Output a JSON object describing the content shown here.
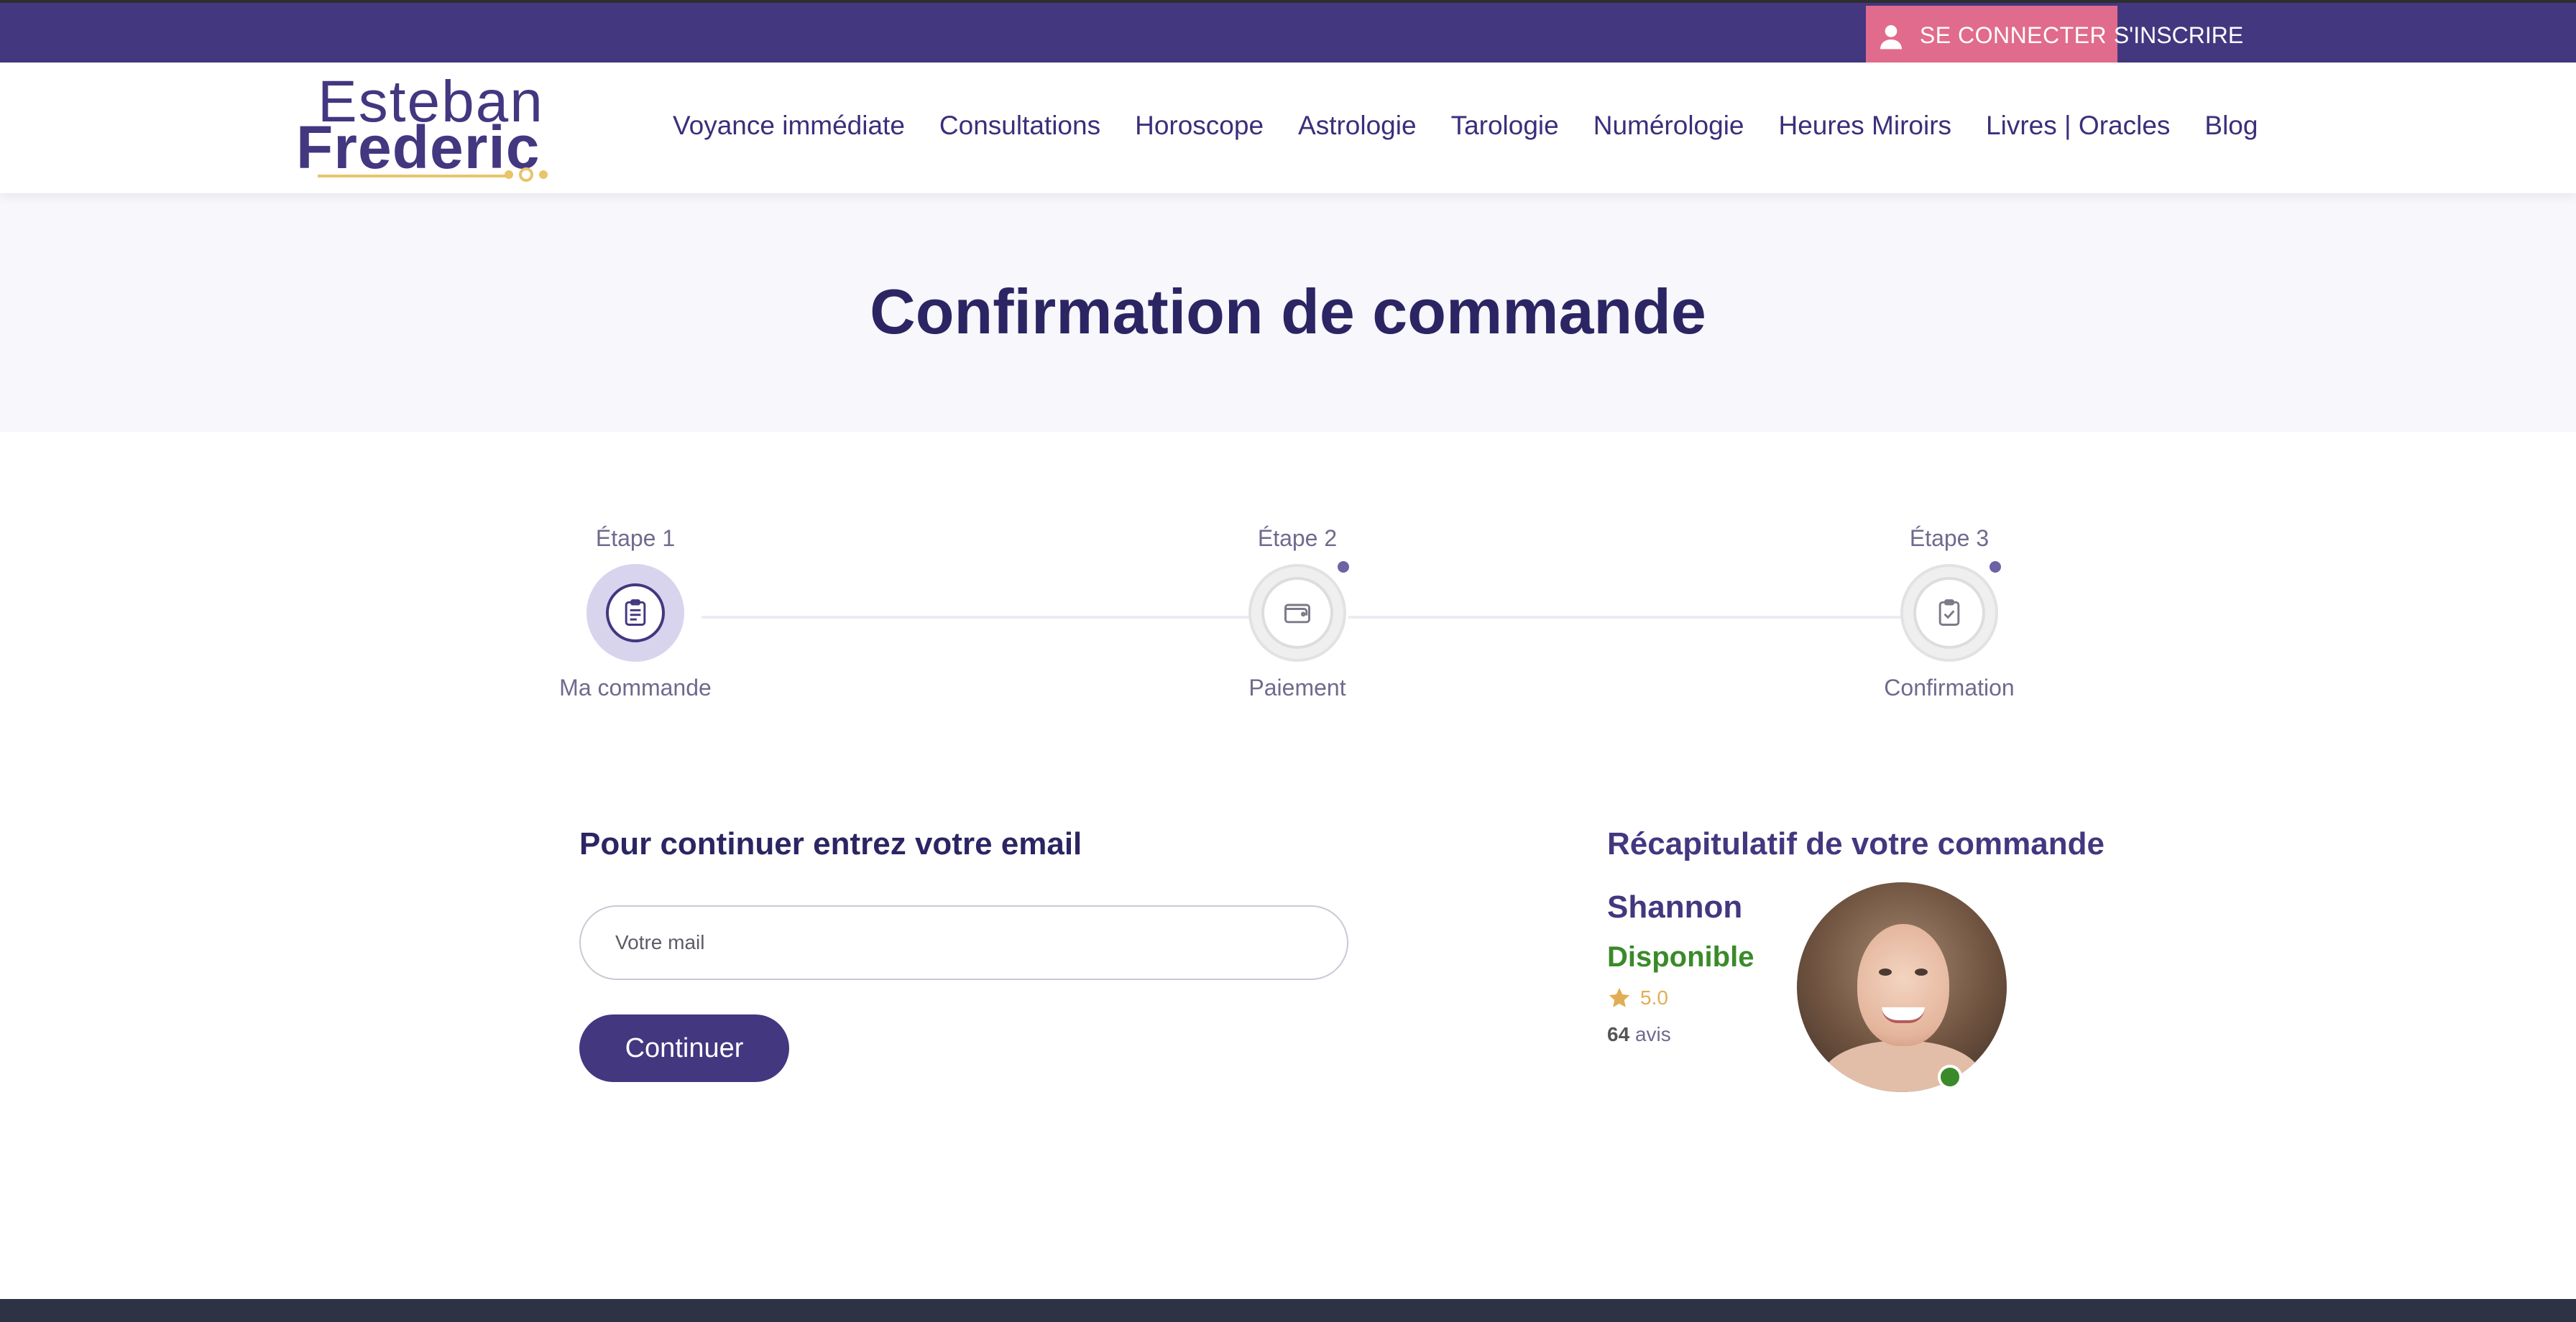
{
  "topbar": {
    "login_label": "SE CONNECTER",
    "signup_label": "S'INSCRIRE",
    "login_icon": "user-icon"
  },
  "logo": {
    "line1": "Esteban",
    "line2": "Frederic"
  },
  "nav": {
    "items": [
      {
        "label": "Voyance immédiate"
      },
      {
        "label": "Consultations"
      },
      {
        "label": "Horoscope"
      },
      {
        "label": "Astrologie"
      },
      {
        "label": "Tarologie"
      },
      {
        "label": "Numérologie"
      },
      {
        "label": "Heures Miroirs"
      },
      {
        "label": "Livres | Oracles"
      },
      {
        "label": "Blog"
      }
    ]
  },
  "page": {
    "title": "Confirmation de commande"
  },
  "steps": [
    {
      "title": "Étape 1",
      "label": "Ma commande",
      "icon": "clipboard-list-icon",
      "active": true
    },
    {
      "title": "Étape 2",
      "label": "Paiement",
      "icon": "wallet-icon",
      "active": false
    },
    {
      "title": "Étape 3",
      "label": "Confirmation",
      "icon": "clipboard-check-icon",
      "active": false
    }
  ],
  "form": {
    "title": "Pour continuer entrez votre email",
    "email_placeholder": "Votre mail",
    "email_value": "",
    "submit_label": "Continuer"
  },
  "summary": {
    "title": "Récapitulatif de votre commande",
    "advisor_name": "Shannon",
    "availability": "Disponible",
    "rating": "5.0",
    "reviews_count": "64",
    "reviews_label": "avis"
  },
  "colors": {
    "brand": "#433780",
    "accent_pink": "#e16b8c",
    "available_green": "#3a8a2a",
    "star": "#e2ae55"
  }
}
